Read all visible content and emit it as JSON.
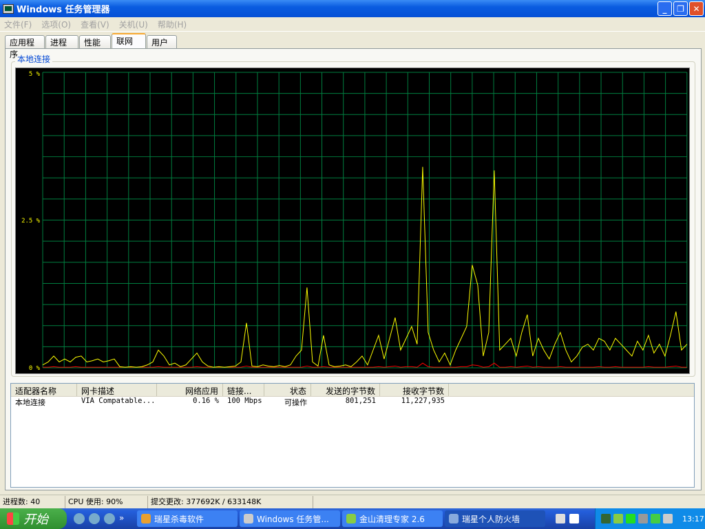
{
  "window": {
    "title": "Windows 任务管理器",
    "minimize": "_",
    "restore": "❐",
    "close": "✕"
  },
  "menu": [
    "文件(F)",
    "选项(O)",
    "查看(V)",
    "关机(U)",
    "帮助(H)"
  ],
  "tabs": [
    {
      "label": "应用程序"
    },
    {
      "label": "进程"
    },
    {
      "label": "性能"
    },
    {
      "label": "联网",
      "active": true
    },
    {
      "label": "用户"
    }
  ],
  "group": {
    "label": "本地连接"
  },
  "chart_data": {
    "type": "line",
    "title": "本地连接",
    "ylim": [
      0,
      5
    ],
    "yticks": [
      "5 %",
      "2.5 %",
      "0 %"
    ],
    "grid": true,
    "colors": {
      "background": "#000000",
      "grid": "#008040",
      "line": "#ffff00",
      "line2": "#ff0000"
    },
    "series": [
      {
        "color": "#ffff00",
        "values": [
          0.05,
          0.1,
          0.2,
          0.1,
          0.15,
          0.1,
          0.18,
          0.2,
          0.1,
          0.12,
          0.15,
          0.1,
          0.12,
          0.15,
          0.02,
          0.01,
          0.02,
          0.01,
          0.02,
          0.05,
          0.1,
          0.3,
          0.2,
          0.05,
          0.08,
          0.02,
          0.05,
          0.15,
          0.25,
          0.1,
          0.03,
          0.01,
          0.02,
          0.01,
          0.02,
          0.03,
          0.1,
          0.76,
          0.03,
          0.02,
          0.05,
          0.03,
          0.02,
          0.04,
          0.02,
          0.05,
          0.2,
          0.3,
          1.36,
          0.1,
          0.03,
          0.55,
          0.05,
          0.02,
          0.03,
          0.05,
          0.02,
          0.1,
          0.2,
          0.05,
          0.3,
          0.55,
          0.15,
          0.5,
          0.85,
          0.3,
          0.5,
          0.7,
          0.4,
          3.4,
          0.6,
          0.3,
          0.1,
          0.25,
          0.05,
          0.3,
          0.5,
          0.7,
          1.74,
          1.4,
          0.2,
          0.6,
          3.34,
          0.3,
          0.4,
          0.5,
          0.2,
          0.6,
          0.9,
          0.2,
          0.5,
          0.3,
          0.15,
          0.4,
          0.6,
          0.3,
          0.1,
          0.2,
          0.35,
          0.4,
          0.3,
          0.5,
          0.45,
          0.3,
          0.5,
          0.4,
          0.3,
          0.2,
          0.45,
          0.3,
          0.55,
          0.25,
          0.4,
          0.2,
          0.55,
          0.95,
          0.3,
          0.4
        ]
      },
      {
        "color": "#ff0000",
        "values": [
          0.01,
          0.01,
          0.02,
          0.01,
          0.01,
          0.01,
          0.02,
          0.01,
          0.01,
          0.01,
          0.01,
          0.01,
          0.01,
          0.01,
          0.01,
          0.01,
          0.01,
          0.01,
          0.01,
          0.01,
          0.01,
          0.02,
          0.01,
          0.01,
          0.01,
          0.01,
          0.01,
          0.01,
          0.02,
          0.01,
          0.01,
          0.01,
          0.01,
          0.01,
          0.01,
          0.01,
          0.01,
          0.03,
          0.01,
          0.01,
          0.01,
          0.01,
          0.01,
          0.01,
          0.01,
          0.01,
          0.01,
          0.01,
          0.03,
          0.01,
          0.01,
          0.02,
          0.01,
          0.01,
          0.01,
          0.01,
          0.01,
          0.01,
          0.01,
          0.01,
          0.01,
          0.02,
          0.01,
          0.02,
          0.03,
          0.01,
          0.02,
          0.02,
          0.01,
          0.08,
          0.02,
          0.01,
          0.01,
          0.01,
          0.01,
          0.01,
          0.02,
          0.02,
          0.05,
          0.04,
          0.01,
          0.02,
          0.08,
          0.01,
          0.01,
          0.02,
          0.01,
          0.02,
          0.03,
          0.01,
          0.02,
          0.01,
          0.01,
          0.01,
          0.02,
          0.01,
          0.01,
          0.01,
          0.01,
          0.01,
          0.01,
          0.02,
          0.01,
          0.01,
          0.02,
          0.01,
          0.01,
          0.01,
          0.01,
          0.01,
          0.02,
          0.01,
          0.01,
          0.01,
          0.02,
          0.03,
          0.01,
          0.01
        ]
      }
    ]
  },
  "adapters": {
    "columns": [
      "适配器名称",
      "网卡描述",
      "网络应用",
      "链接...",
      "状态",
      "发送的字节数",
      "接收字节数"
    ],
    "rows": [
      [
        "本地连接",
        "VIA Compatable...",
        "0.16 %",
        "100 Mbps",
        "可操作",
        "801,251",
        "11,227,935"
      ]
    ]
  },
  "status": {
    "processes": "进程数: 40",
    "cpu": "CPU 使用: 90%",
    "commit": "提交更改: 377692K / 633148K"
  },
  "taskbar": {
    "start": "开始",
    "chevron": "»",
    "tasks": [
      {
        "label": "瑞星杀毒软件"
      },
      {
        "label": "Windows 任务管..."
      },
      {
        "label": "金山清理专家 2.6"
      },
      {
        "label": "瑞星个人防火墙",
        "active": true
      }
    ],
    "clock": "13:17"
  }
}
